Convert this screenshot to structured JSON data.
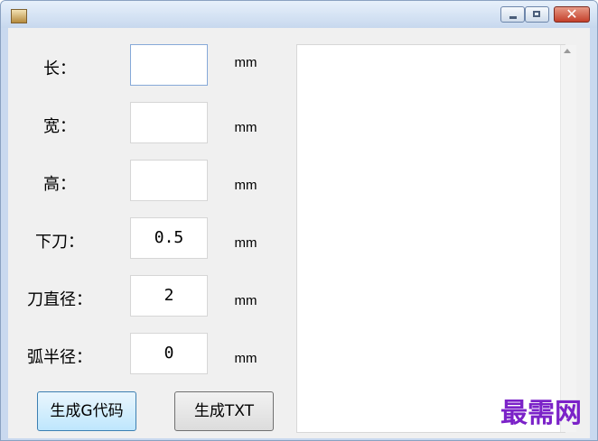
{
  "window": {
    "icon": "app-icon",
    "controls": [
      "minimize-icon",
      "maximize-icon",
      "close-icon"
    ],
    "close_glyph": "✕"
  },
  "form": {
    "rows": [
      {
        "label": "长：",
        "value": "",
        "unit": "mm",
        "focused": true
      },
      {
        "label": "宽：",
        "value": "",
        "unit": "mm"
      },
      {
        "label": "高：",
        "value": "",
        "unit": "mm"
      },
      {
        "label": "下刀：",
        "value": "0.5",
        "unit": "mm"
      },
      {
        "label": "刀直径：",
        "value": "2",
        "unit": "mm"
      },
      {
        "label": "弧半径：",
        "value": "0",
        "unit": "mm"
      }
    ],
    "buttons": {
      "gcode": "生成G代码",
      "txt": "生成TXT"
    }
  },
  "output": {
    "text": ""
  },
  "watermark": "最需网",
  "colors": {
    "watermark": "#7b22c8",
    "focus_border": "#86a9d8"
  }
}
